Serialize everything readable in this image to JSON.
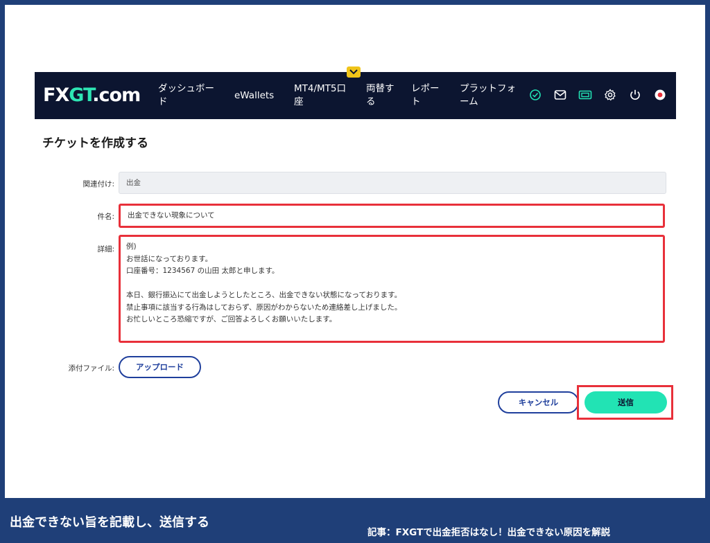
{
  "nav": {
    "logo": {
      "prefix": "FX",
      "accent": "GT",
      "suffix": ".com"
    },
    "items": [
      {
        "label": "ダッシュボー\nド"
      },
      {
        "label": "eWallets"
      },
      {
        "label": "MT4/MT5口\n座"
      },
      {
        "label": "両替す\nる"
      },
      {
        "label": "レポー\nト"
      },
      {
        "label": "プラットフォ\nーム"
      }
    ],
    "icons": [
      "check-circle-icon",
      "mail-icon",
      "ticket-icon",
      "gear-icon",
      "power-icon",
      "flag-japan-icon"
    ]
  },
  "page": {
    "title": "チケットを作成する"
  },
  "form": {
    "related_label": "関連付け:",
    "related_value": "出金",
    "subject_label": "件名:",
    "subject_value": "出金できない現象について",
    "detail_label": "詳細:",
    "detail_value": "例)\nお世話になっております。\n口座番号：1234567 の山田 太郎と申します。\n\n本日、銀行振込にて出金しようとしたところ、出金できない状態になっております。\n禁止事項に該当する行為はしておらず、原因がわからないため連絡差し上げました。\nお忙しいところ恐縮ですが、ご回答よろしくお願いいたします。",
    "attachment_label": "添付ファイル:",
    "upload_label": "アップロード",
    "cancel_label": "キャンセル",
    "send_label": "送信"
  },
  "caption": {
    "main": "出金できない旨を記載し、送信する",
    "sub": "記事：FXGTで出金拒否はなし！出金できない原因を解説"
  },
  "colors": {
    "nav_bg": "#0c1530",
    "accent_green": "#22e3b4",
    "highlight_red": "#e8303a",
    "button_blue": "#1f3f9c",
    "caption_bg": "#1f3f78"
  }
}
